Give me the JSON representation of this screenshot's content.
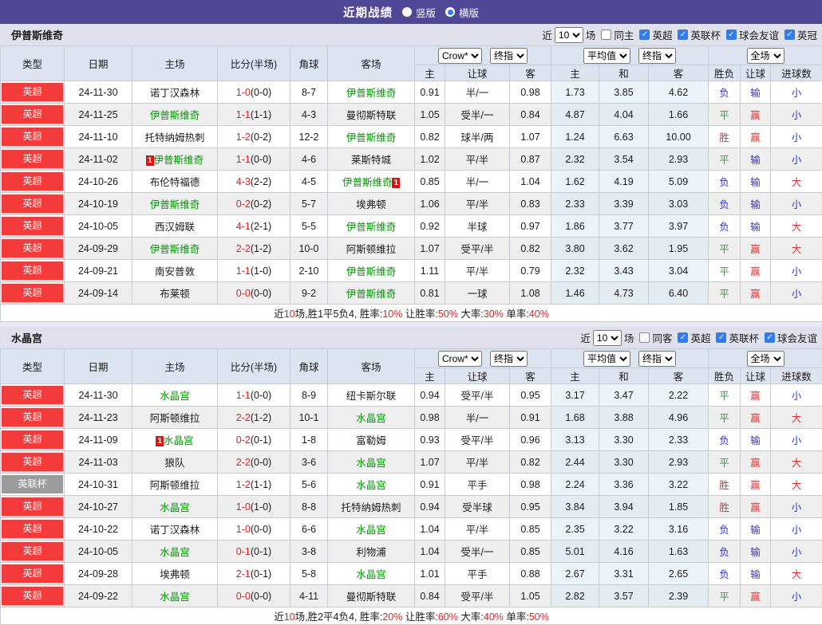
{
  "topbar": {
    "title": "近期战绩",
    "radios": [
      {
        "label": "竖版",
        "selected": false
      },
      {
        "label": "横版",
        "selected": true
      }
    ]
  },
  "filter_labels": {
    "near": "近",
    "matches": "场"
  },
  "columns": {
    "left": [
      "类型",
      "日期",
      "主场",
      "比分(半场)",
      "角球",
      "客场"
    ],
    "group1_selects": [
      "Crow*",
      "终指"
    ],
    "group2_selects": [
      "平均值",
      "终指"
    ],
    "group3_selects": [
      "全场"
    ],
    "sub": [
      "主",
      "让球",
      "客",
      "主",
      "和",
      "客",
      "胜负",
      "让球",
      "进球数"
    ]
  },
  "colors": {
    "accent_purple": "#4e4896",
    "badge_red": "#f43b3b",
    "badge_gray": "#9b9b9b",
    "team_green": "#009900",
    "score_red": "#e02222",
    "win_red": "#e03333",
    "draw_green": "#2e9e2e",
    "lose_blue": "#3333cc",
    "avg_col_bg": "#eaf4f9",
    "checkbox_blue": "#2e7cf6"
  },
  "sections": [
    {
      "team": "伊普斯维奇",
      "count": "10",
      "same_label": "同主",
      "leagues": [
        "英超",
        "英联杯",
        "球会友谊",
        "英冠"
      ],
      "rows": [
        {
          "type": "英超",
          "type_color": "red",
          "date": "24-11-30",
          "home": {
            "name": "诺丁汉森林",
            "green": false,
            "card": ""
          },
          "score": {
            "full": "1-0",
            "half": "(0-0)"
          },
          "corner": "8-7",
          "away": {
            "name": "伊普斯维奇",
            "green": true,
            "card": ""
          },
          "odds": [
            "0.91",
            "半/一",
            "0.98"
          ],
          "avg": [
            "1.73",
            "3.85",
            "4.62"
          ],
          "results": [
            [
              "负",
              "b"
            ],
            [
              "输",
              "b"
            ],
            [
              "小",
              "b"
            ]
          ]
        },
        {
          "type": "英超",
          "type_color": "red",
          "date": "24-11-25",
          "home": {
            "name": "伊普斯维奇",
            "green": true,
            "card": ""
          },
          "score": {
            "full": "1-1",
            "half": "(1-1)"
          },
          "corner": "4-3",
          "away": {
            "name": "曼彻斯特联",
            "green": false,
            "card": ""
          },
          "odds": [
            "1.05",
            "受半/一",
            "0.84"
          ],
          "avg": [
            "4.87",
            "4.04",
            "1.66"
          ],
          "results": [
            [
              "平",
              "g"
            ],
            [
              "赢",
              "r"
            ],
            [
              "小",
              "b"
            ]
          ]
        },
        {
          "type": "英超",
          "type_color": "red",
          "date": "24-11-10",
          "home": {
            "name": "托特纳姆热刺",
            "green": false,
            "card": ""
          },
          "score": {
            "full": "1-2",
            "half": "(0-2)"
          },
          "corner": "12-2",
          "away": {
            "name": "伊普斯维奇",
            "green": true,
            "card": ""
          },
          "odds": [
            "0.82",
            "球半/两",
            "1.07"
          ],
          "avg": [
            "1.24",
            "6.63",
            "10.00"
          ],
          "results": [
            [
              "胜",
              "r"
            ],
            [
              "赢",
              "r"
            ],
            [
              "小",
              "b"
            ]
          ]
        },
        {
          "type": "英超",
          "type_color": "red",
          "date": "24-11-02",
          "home": {
            "name": "伊普斯维奇",
            "green": true,
            "card": "before"
          },
          "score": {
            "full": "1-1",
            "half": "(0-0)"
          },
          "corner": "4-6",
          "away": {
            "name": "莱斯特城",
            "green": false,
            "card": ""
          },
          "odds": [
            "1.02",
            "平/半",
            "0.87"
          ],
          "avg": [
            "2.32",
            "3.54",
            "2.93"
          ],
          "results": [
            [
              "平",
              "g"
            ],
            [
              "输",
              "b"
            ],
            [
              "小",
              "b"
            ]
          ]
        },
        {
          "type": "英超",
          "type_color": "red",
          "date": "24-10-26",
          "home": {
            "name": "布伦特福德",
            "green": false,
            "card": ""
          },
          "score": {
            "full": "4-3",
            "half": "(2-2)"
          },
          "corner": "4-5",
          "away": {
            "name": "伊普斯维奇",
            "green": true,
            "card": "after"
          },
          "odds": [
            "0.85",
            "半/一",
            "1.04"
          ],
          "avg": [
            "1.62",
            "4.19",
            "5.09"
          ],
          "results": [
            [
              "负",
              "b"
            ],
            [
              "输",
              "b"
            ],
            [
              "大",
              "r"
            ]
          ]
        },
        {
          "type": "英超",
          "type_color": "red",
          "date": "24-10-19",
          "home": {
            "name": "伊普斯维奇",
            "green": true,
            "card": ""
          },
          "score": {
            "full": "0-2",
            "half": "(0-2)"
          },
          "corner": "5-7",
          "away": {
            "name": "埃弗顿",
            "green": false,
            "card": ""
          },
          "odds": [
            "1.06",
            "平/半",
            "0.83"
          ],
          "avg": [
            "2.33",
            "3.39",
            "3.03"
          ],
          "results": [
            [
              "负",
              "b"
            ],
            [
              "输",
              "b"
            ],
            [
              "小",
              "b"
            ]
          ]
        },
        {
          "type": "英超",
          "type_color": "red",
          "date": "24-10-05",
          "home": {
            "name": "西汉姆联",
            "green": false,
            "card": ""
          },
          "score": {
            "full": "4-1",
            "half": "(2-1)"
          },
          "corner": "5-5",
          "away": {
            "name": "伊普斯维奇",
            "green": true,
            "card": ""
          },
          "odds": [
            "0.92",
            "半球",
            "0.97"
          ],
          "avg": [
            "1.86",
            "3.77",
            "3.97"
          ],
          "results": [
            [
              "负",
              "b"
            ],
            [
              "输",
              "b"
            ],
            [
              "大",
              "r"
            ]
          ]
        },
        {
          "type": "英超",
          "type_color": "red",
          "date": "24-09-29",
          "home": {
            "name": "伊普斯维奇",
            "green": true,
            "card": ""
          },
          "score": {
            "full": "2-2",
            "half": "(1-2)"
          },
          "corner": "10-0",
          "away": {
            "name": "阿斯顿维拉",
            "green": false,
            "card": ""
          },
          "odds": [
            "1.07",
            "受平/半",
            "0.82"
          ],
          "avg": [
            "3.80",
            "3.62",
            "1.95"
          ],
          "results": [
            [
              "平",
              "g"
            ],
            [
              "赢",
              "r"
            ],
            [
              "大",
              "r"
            ]
          ]
        },
        {
          "type": "英超",
          "type_color": "red",
          "date": "24-09-21",
          "home": {
            "name": "南安普敦",
            "green": false,
            "card": ""
          },
          "score": {
            "full": "1-1",
            "half": "(1-0)"
          },
          "corner": "2-10",
          "away": {
            "name": "伊普斯维奇",
            "green": true,
            "card": ""
          },
          "odds": [
            "1.11",
            "平/半",
            "0.79"
          ],
          "avg": [
            "2.32",
            "3.43",
            "3.04"
          ],
          "results": [
            [
              "平",
              "g"
            ],
            [
              "赢",
              "r"
            ],
            [
              "小",
              "b"
            ]
          ]
        },
        {
          "type": "英超",
          "type_color": "red",
          "date": "24-09-14",
          "home": {
            "name": "布莱顿",
            "green": false,
            "card": ""
          },
          "score": {
            "full": "0-0",
            "half": "(0-0)"
          },
          "corner": "9-2",
          "away": {
            "name": "伊普斯维奇",
            "green": true,
            "card": ""
          },
          "odds": [
            "0.81",
            "一球",
            "1.08"
          ],
          "avg": [
            "1.46",
            "4.73",
            "6.40"
          ],
          "results": [
            [
              "平",
              "g"
            ],
            [
              "赢",
              "r"
            ],
            [
              "小",
              "b"
            ]
          ]
        }
      ],
      "summary": [
        [
          "近",
          false
        ],
        [
          "10",
          true
        ],
        [
          "场,胜1平5负4, 胜率:",
          false
        ],
        [
          "10%",
          true
        ],
        [
          " 让胜率:",
          false
        ],
        [
          "50%",
          true
        ],
        [
          " 大率:",
          false
        ],
        [
          "30%",
          true
        ],
        [
          " 单率:",
          false
        ],
        [
          "40%",
          true
        ]
      ]
    },
    {
      "team": "水晶宫",
      "count": "10",
      "same_label": "同客",
      "leagues": [
        "英超",
        "英联杯",
        "球会友谊"
      ],
      "rows": [
        {
          "type": "英超",
          "type_color": "red",
          "date": "24-11-30",
          "home": {
            "name": "水晶宫",
            "green": true,
            "card": ""
          },
          "score": {
            "full": "1-1",
            "half": "(0-0)"
          },
          "corner": "8-9",
          "away": {
            "name": "纽卡斯尔联",
            "green": false,
            "card": ""
          },
          "odds": [
            "0.94",
            "受平/半",
            "0.95"
          ],
          "avg": [
            "3.17",
            "3.47",
            "2.22"
          ],
          "results": [
            [
              "平",
              "g"
            ],
            [
              "赢",
              "r"
            ],
            [
              "小",
              "b"
            ]
          ]
        },
        {
          "type": "英超",
          "type_color": "red",
          "date": "24-11-23",
          "home": {
            "name": "阿斯顿维拉",
            "green": false,
            "card": ""
          },
          "score": {
            "full": "2-2",
            "half": "(1-2)"
          },
          "corner": "10-1",
          "away": {
            "name": "水晶宫",
            "green": true,
            "card": ""
          },
          "odds": [
            "0.98",
            "半/一",
            "0.91"
          ],
          "avg": [
            "1.68",
            "3.88",
            "4.96"
          ],
          "results": [
            [
              "平",
              "g"
            ],
            [
              "赢",
              "r"
            ],
            [
              "大",
              "r"
            ]
          ]
        },
        {
          "type": "英超",
          "type_color": "red",
          "date": "24-11-09",
          "home": {
            "name": "水晶宫",
            "green": true,
            "card": "before"
          },
          "score": {
            "full": "0-2",
            "half": "(0-1)"
          },
          "corner": "1-8",
          "away": {
            "name": "富勒姆",
            "green": false,
            "card": ""
          },
          "odds": [
            "0.93",
            "受平/半",
            "0.96"
          ],
          "avg": [
            "3.13",
            "3.30",
            "2.33"
          ],
          "results": [
            [
              "负",
              "b"
            ],
            [
              "输",
              "b"
            ],
            [
              "小",
              "b"
            ]
          ]
        },
        {
          "type": "英超",
          "type_color": "red",
          "date": "24-11-03",
          "home": {
            "name": "狼队",
            "green": false,
            "card": ""
          },
          "score": {
            "full": "2-2",
            "half": "(0-0)"
          },
          "corner": "3-6",
          "away": {
            "name": "水晶宫",
            "green": true,
            "card": ""
          },
          "odds": [
            "1.07",
            "平/半",
            "0.82"
          ],
          "avg": [
            "2.44",
            "3.30",
            "2.93"
          ],
          "results": [
            [
              "平",
              "g"
            ],
            [
              "赢",
              "r"
            ],
            [
              "大",
              "r"
            ]
          ]
        },
        {
          "type": "英联杯",
          "type_color": "gray",
          "date": "24-10-31",
          "home": {
            "name": "阿斯顿维拉",
            "green": false,
            "card": ""
          },
          "score": {
            "full": "1-2",
            "half": "(1-1)"
          },
          "corner": "5-6",
          "away": {
            "name": "水晶宫",
            "green": true,
            "card": ""
          },
          "odds": [
            "0.91",
            "平手",
            "0.98"
          ],
          "avg": [
            "2.24",
            "3.36",
            "3.22"
          ],
          "results": [
            [
              "胜",
              "r"
            ],
            [
              "赢",
              "r"
            ],
            [
              "大",
              "r"
            ]
          ]
        },
        {
          "type": "英超",
          "type_color": "red",
          "date": "24-10-27",
          "home": {
            "name": "水晶宫",
            "green": true,
            "card": ""
          },
          "score": {
            "full": "1-0",
            "half": "(1-0)"
          },
          "corner": "8-8",
          "away": {
            "name": "托特纳姆热刺",
            "green": false,
            "card": ""
          },
          "odds": [
            "0.94",
            "受半球",
            "0.95"
          ],
          "avg": [
            "3.84",
            "3.94",
            "1.85"
          ],
          "results": [
            [
              "胜",
              "r"
            ],
            [
              "赢",
              "r"
            ],
            [
              "小",
              "b"
            ]
          ]
        },
        {
          "type": "英超",
          "type_color": "red",
          "date": "24-10-22",
          "home": {
            "name": "诺丁汉森林",
            "green": false,
            "card": ""
          },
          "score": {
            "full": "1-0",
            "half": "(0-0)"
          },
          "corner": "6-6",
          "away": {
            "name": "水晶宫",
            "green": true,
            "card": ""
          },
          "odds": [
            "1.04",
            "平/半",
            "0.85"
          ],
          "avg": [
            "2.35",
            "3.22",
            "3.16"
          ],
          "results": [
            [
              "负",
              "b"
            ],
            [
              "输",
              "b"
            ],
            [
              "小",
              "b"
            ]
          ]
        },
        {
          "type": "英超",
          "type_color": "red",
          "date": "24-10-05",
          "home": {
            "name": "水晶宫",
            "green": true,
            "card": ""
          },
          "score": {
            "full": "0-1",
            "half": "(0-1)"
          },
          "corner": "3-8",
          "away": {
            "name": "利物浦",
            "green": false,
            "card": ""
          },
          "odds": [
            "1.04",
            "受半/一",
            "0.85"
          ],
          "avg": [
            "5.01",
            "4.16",
            "1.63"
          ],
          "results": [
            [
              "负",
              "b"
            ],
            [
              "输",
              "b"
            ],
            [
              "小",
              "b"
            ]
          ]
        },
        {
          "type": "英超",
          "type_color": "red",
          "date": "24-09-28",
          "home": {
            "name": "埃弗顿",
            "green": false,
            "card": ""
          },
          "score": {
            "full": "2-1",
            "half": "(0-1)"
          },
          "corner": "5-8",
          "away": {
            "name": "水晶宫",
            "green": true,
            "card": ""
          },
          "odds": [
            "1.01",
            "平手",
            "0.88"
          ],
          "avg": [
            "2.67",
            "3.31",
            "2.65"
          ],
          "results": [
            [
              "负",
              "b"
            ],
            [
              "输",
              "b"
            ],
            [
              "大",
              "r"
            ]
          ]
        },
        {
          "type": "英超",
          "type_color": "red",
          "date": "24-09-22",
          "home": {
            "name": "水晶宫",
            "green": true,
            "card": ""
          },
          "score": {
            "full": "0-0",
            "half": "(0-0)"
          },
          "corner": "4-11",
          "away": {
            "name": "曼彻斯特联",
            "green": false,
            "card": ""
          },
          "odds": [
            "0.84",
            "受平/半",
            "1.05"
          ],
          "avg": [
            "2.82",
            "3.57",
            "2.39"
          ],
          "results": [
            [
              "平",
              "g"
            ],
            [
              "赢",
              "r"
            ],
            [
              "小",
              "b"
            ]
          ]
        }
      ],
      "summary": [
        [
          "近",
          false
        ],
        [
          "10",
          true
        ],
        [
          "场,胜2平4负4, 胜率:",
          false
        ],
        [
          "20%",
          true
        ],
        [
          " 让胜率:",
          false
        ],
        [
          "60%",
          true
        ],
        [
          " 大率:",
          false
        ],
        [
          "40%",
          true
        ],
        [
          " 单率:",
          false
        ],
        [
          "50%",
          true
        ]
      ]
    }
  ]
}
